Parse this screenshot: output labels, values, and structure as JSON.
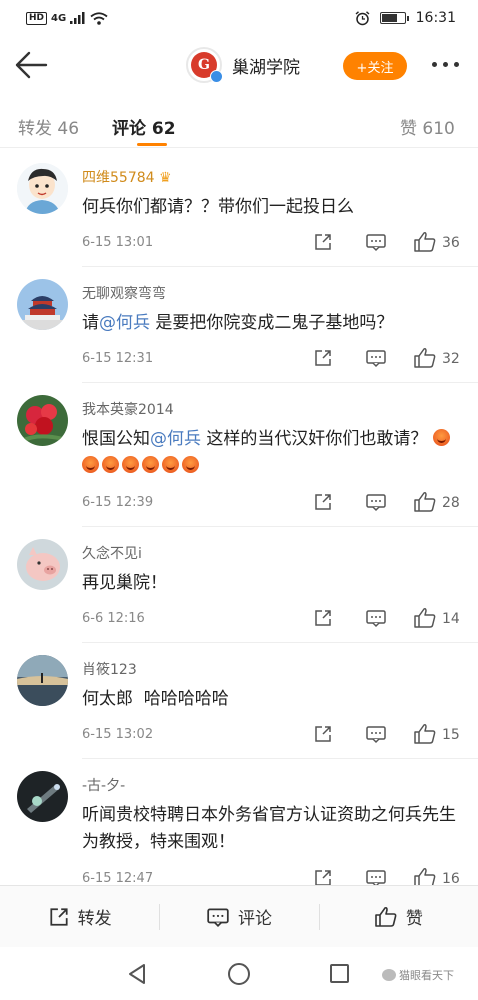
{
  "status_bar": {
    "network": "HD",
    "signal": "4G",
    "time": "16:31"
  },
  "nav": {
    "title": "巢湖学院",
    "follow_label": "+关注",
    "avatar_icon": "school-logo-icon"
  },
  "tabs": [
    {
      "label": "转发 46",
      "active": false
    },
    {
      "label": "评论 62",
      "active": true
    },
    {
      "label": "赞 610",
      "active": false
    }
  ],
  "comments": [
    {
      "name": "四维55784",
      "text": "何兵你们都请？？带你们一起投日么",
      "time": "6-15 13:01",
      "likes": "36"
    },
    {
      "name": "无聊观察弯弯",
      "text_pre": "请",
      "mention": "@何兵",
      "text_post": " 是要把你院变成二鬼子基地吗？",
      "time": "6-15 12:31",
      "likes": "32"
    },
    {
      "name": "我本英豪2014",
      "text_pre": "恨国公知",
      "mention": "@何兵",
      "text_post": " 这样的当代汉奸你们也敢请？",
      "time": "6-15 12:39",
      "likes": "28"
    },
    {
      "name": "久念不见i",
      "text": "再见巢院！",
      "time": "6-6 12:16",
      "likes": "14"
    },
    {
      "name": "肖筱123",
      "text": "何太郎  哈哈哈哈哈",
      "time": "6-15 13:02",
      "likes": "15"
    },
    {
      "name": "-古-夕-",
      "text": "听闻贵校特聘日本外务省官方认证资助之何兵先生为教授，特来围观！",
      "time": "6-15 12:47",
      "likes": "16"
    }
  ],
  "actions": {
    "repost": "转发",
    "comment": "评论",
    "like": "赞"
  },
  "watermark": "猫眼看天下",
  "colors": {
    "accent": "#ff8200",
    "mention": "#4a7bbf",
    "gold_name": "#d08b1c"
  }
}
